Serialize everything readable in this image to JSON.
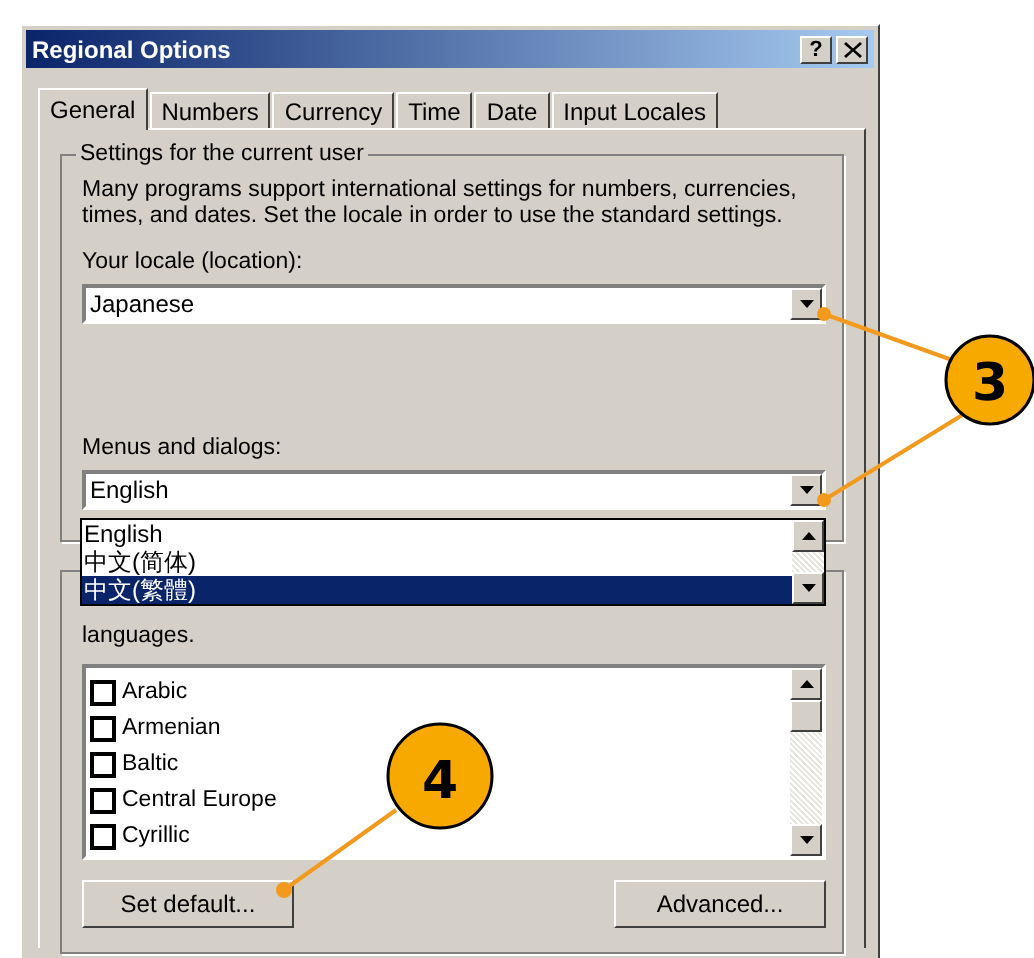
{
  "window": {
    "title": "Regional Options",
    "help_button": "?"
  },
  "tabs": [
    {
      "label": "General",
      "selected": true
    },
    {
      "label": "Numbers",
      "selected": false
    },
    {
      "label": "Currency",
      "selected": false
    },
    {
      "label": "Time",
      "selected": false
    },
    {
      "label": "Date",
      "selected": false
    },
    {
      "label": "Input Locales",
      "selected": false
    }
  ],
  "user_settings": {
    "group_label": "Settings for the current user",
    "description": "Many programs support international settings for numbers, currencies, times, and dates. Set the locale in order to use the standard settings.",
    "locale_label": "Your locale (location):",
    "locale_value": "Japanese",
    "menus_label": "Menus and dialogs:",
    "menus_value": "English",
    "menus_options": [
      {
        "label": "English",
        "selected": false
      },
      {
        "label": "中文(简体)",
        "selected": false
      },
      {
        "label": "中文(繁體)",
        "selected": true
      }
    ]
  },
  "language_settings": {
    "description": "languages.",
    "languages": [
      {
        "label": "Arabic",
        "checked": false
      },
      {
        "label": "Armenian",
        "checked": false
      },
      {
        "label": "Baltic",
        "checked": false
      },
      {
        "label": "Central Europe",
        "checked": false
      },
      {
        "label": "Cyrillic",
        "checked": false
      }
    ]
  },
  "buttons": [
    "Set default...",
    "Advanced..."
  ],
  "callouts": [
    {
      "number": "3"
    },
    {
      "number": "4"
    }
  ]
}
